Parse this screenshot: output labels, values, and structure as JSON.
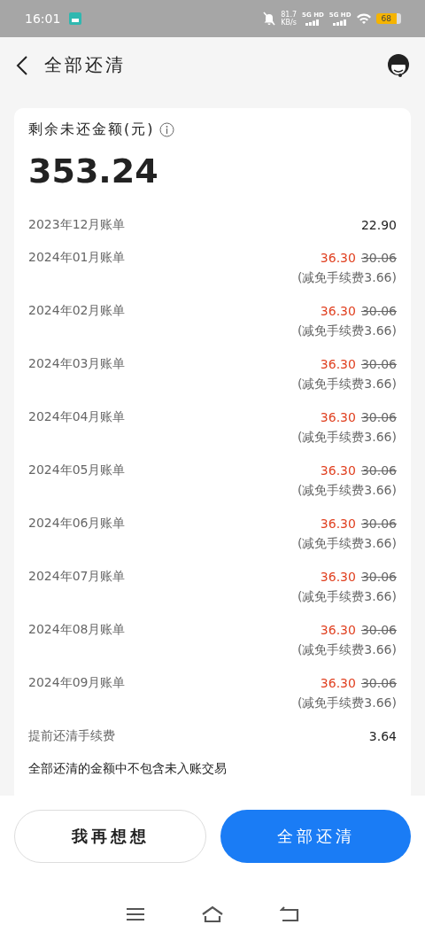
{
  "status_bar": {
    "time": "16:01",
    "net_speed": "81.7",
    "net_unit": "KB/s",
    "signals": [
      "5G HD",
      "5G HD"
    ],
    "battery": "68"
  },
  "header": {
    "title": "全部还清"
  },
  "summary": {
    "label": "剩余未还金额(元)",
    "amount": "353.24"
  },
  "bills": [
    {
      "kind": "plain",
      "label": "2023年12月账单",
      "amount": "22.90"
    },
    {
      "kind": "discounted",
      "label": "2024年01月账单",
      "amount": "36.30",
      "original": "30.06",
      "note": "(减免手续费3.66)"
    },
    {
      "kind": "discounted",
      "label": "2024年02月账单",
      "amount": "36.30",
      "original": "30.06",
      "note": "(减免手续费3.66)"
    },
    {
      "kind": "discounted",
      "label": "2024年03月账单",
      "amount": "36.30",
      "original": "30.06",
      "note": "(减免手续费3.66)"
    },
    {
      "kind": "discounted",
      "label": "2024年04月账单",
      "amount": "36.30",
      "original": "30.06",
      "note": "(减免手续费3.66)"
    },
    {
      "kind": "discounted",
      "label": "2024年05月账单",
      "amount": "36.30",
      "original": "30.06",
      "note": "(减免手续费3.66)"
    },
    {
      "kind": "discounted",
      "label": "2024年06月账单",
      "amount": "36.30",
      "original": "30.06",
      "note": "(减免手续费3.66)"
    },
    {
      "kind": "discounted",
      "label": "2024年07月账单",
      "amount": "36.30",
      "original": "30.06",
      "note": "(减免手续费3.66)"
    },
    {
      "kind": "discounted",
      "label": "2024年08月账单",
      "amount": "36.30",
      "original": "30.06",
      "note": "(减免手续费3.66)"
    },
    {
      "kind": "discounted",
      "label": "2024年09月账单",
      "amount": "36.30",
      "original": "30.06",
      "note": "(减免手续费3.66)"
    },
    {
      "kind": "plain",
      "label": "提前还清手续费",
      "amount": "3.64"
    }
  ],
  "notice": "全部还清的金额中不包含未入账交易",
  "buttons": [
    {
      "kind": "secondary",
      "label": "我再想想"
    },
    {
      "kind": "primary",
      "label": "全部还清"
    }
  ]
}
